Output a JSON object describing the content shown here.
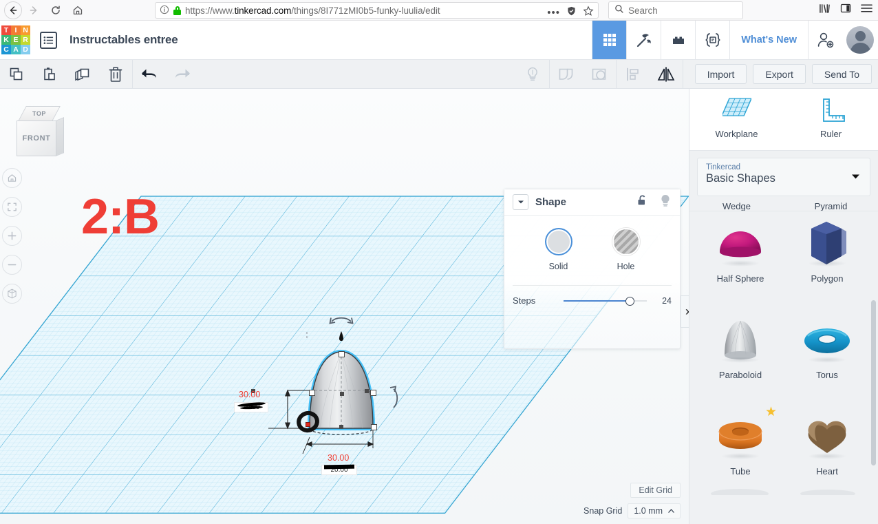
{
  "browser": {
    "back_icon": "arrow-left-icon",
    "forward_icon": "arrow-right-icon",
    "reload_icon": "reload-icon",
    "home_icon": "home-icon",
    "url_prefix": "https://www.",
    "url_domain": "tinkercad.com",
    "url_path": "/things/8I771zMI0b5-funky-luulia/edit",
    "url_full": "https://www.tinkercad.com/things/8I771zMI0b5-funky-luulia/edit",
    "page_info_icon": "info-circle-icon",
    "lock_icon": "padlock-secure-icon",
    "lock_color": "#12bc00",
    "more_icon": "ellipsis-icon",
    "shield_icon": "shield-icon",
    "bookmark_icon": "star-outline-icon",
    "search_placeholder": "Search",
    "search_icon": "search-icon",
    "library_icon": "library-books-icon",
    "sidebar_icon": "sidebar-toggle-icon",
    "menu_icon": "hamburger-menu-icon"
  },
  "logo": {
    "letters": [
      "T",
      "I",
      "N",
      "K",
      "E",
      "R",
      "C",
      "A",
      "D"
    ],
    "colors": [
      "#ef4b3c",
      "#f47b33",
      "#f89b2f",
      "#3cb878",
      "#7ac143",
      "#c4d92e",
      "#1c96d4",
      "#44c0c4",
      "#84cdef"
    ]
  },
  "topbar": {
    "doc_list_icon": "document-list-icon",
    "title": "Instructables entree",
    "nav": [
      {
        "name": "grid-apps-icon",
        "label": "",
        "active": true
      },
      {
        "name": "pickaxe-icon",
        "label": "",
        "active": false
      },
      {
        "name": "blocks-icon",
        "label": "",
        "active": false
      },
      {
        "name": "codeblocks-braces-icon",
        "label": "",
        "active": false
      }
    ],
    "whats_new": "What's New",
    "add_user_icon": "add-person-icon",
    "avatar": "user-avatar"
  },
  "toolbar": {
    "left_tools": [
      {
        "name": "copy-icon",
        "dim": false
      },
      {
        "name": "paste-icon",
        "dim": false
      },
      {
        "name": "duplicate-icon",
        "dim": false
      },
      {
        "name": "delete-trash-icon",
        "dim": false
      }
    ],
    "history_tools": [
      {
        "name": "undo-icon",
        "dim": false
      },
      {
        "name": "redo-icon",
        "dim": true
      }
    ],
    "mid_tools": [
      {
        "name": "lightbulb-icon",
        "dim": true
      },
      {
        "name": "group-icon",
        "dim": true
      },
      {
        "name": "ungroup-icon",
        "dim": true
      },
      {
        "name": "align-icon",
        "dim": true
      },
      {
        "name": "mirror-icon",
        "dim": false
      }
    ],
    "buttons": [
      "Import",
      "Export",
      "Send To"
    ]
  },
  "canvas": {
    "viewcube": {
      "top_label": "TOP",
      "front_label": "FRONT"
    },
    "annotation": "2:B",
    "annotation_color": "#ef3e36",
    "nav_buttons": [
      {
        "name": "home-view-icon"
      },
      {
        "name": "fit-to-view-icon"
      },
      {
        "name": "zoom-in-icon"
      },
      {
        "name": "zoom-out-icon"
      },
      {
        "name": "perspective-toggle-icon"
      }
    ],
    "model": {
      "shape": "paraboloid",
      "selected": true,
      "dim_width_new": "30.00",
      "dim_width_old": "20.00",
      "dim_depth_new": "30.00",
      "dim_depth_old": "20.00",
      "rotate_handle_icon": "rotate-arrow-icon",
      "height_handle_icon": "height-cone-handle-icon"
    },
    "edit_grid": "Edit Grid",
    "snap_grid_label": "Snap Grid",
    "snap_grid_value": "1.0 mm",
    "collapse_chevron": "›"
  },
  "shape_panel": {
    "caret_icon": "chevron-down-icon",
    "title": "Shape",
    "lock_icon": "unlocked-padlock-icon",
    "bulb_icon": "lightbulb-icon",
    "modes": [
      {
        "label": "Solid",
        "name": "solid-swatch",
        "selected": true
      },
      {
        "label": "Hole",
        "name": "hole-swatch",
        "selected": false
      }
    ],
    "steps_label": "Steps",
    "steps_value": "24"
  },
  "right_panel": {
    "tools": [
      {
        "label": "Workplane",
        "icon": "workplane-grid-icon"
      },
      {
        "label": "Ruler",
        "icon": "ruler-icon"
      }
    ],
    "collection_source": "Tinkercad",
    "collection_name": "Basic Shapes",
    "collection_caret": "▼",
    "clipped_labels": [
      "Wedge",
      "Pyramid"
    ],
    "shapes": [
      {
        "label": "Half Sphere",
        "color": "#c2197d",
        "featured": false,
        "thumb": "half-sphere-thumb"
      },
      {
        "label": "Polygon",
        "color": "#3a4f8f",
        "featured": false,
        "thumb": "polygon-thumb"
      },
      {
        "label": "Paraboloid",
        "color": "#b9bcc0",
        "featured": false,
        "thumb": "paraboloid-thumb"
      },
      {
        "label": "Torus",
        "color": "#1593c9",
        "featured": false,
        "thumb": "torus-thumb"
      },
      {
        "label": "Tube",
        "color": "#d97420",
        "featured": true,
        "thumb": "tube-thumb"
      },
      {
        "label": "Heart",
        "color": "#8a6b4a",
        "featured": false,
        "thumb": "heart-thumb"
      }
    ],
    "featured_star": "★",
    "scrollbar": "vertical-scrollbar"
  }
}
